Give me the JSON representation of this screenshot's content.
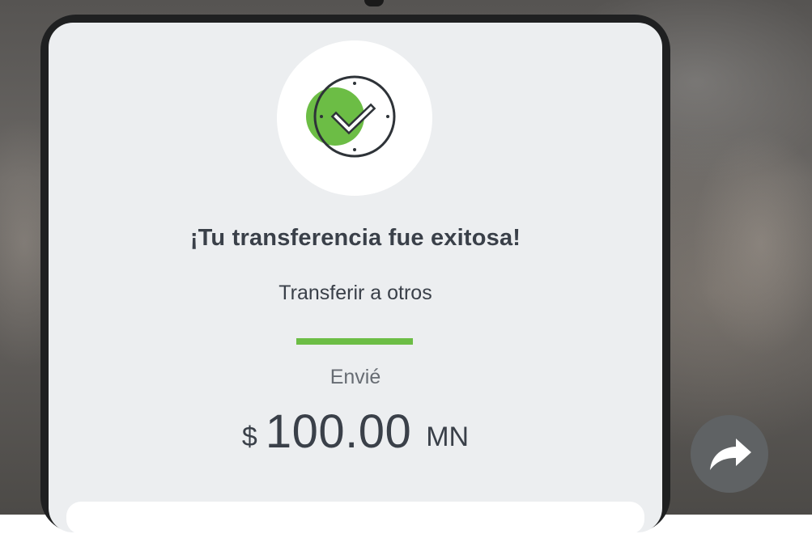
{
  "success": {
    "title": "¡Tu transferencia fue exitosa!",
    "subtitle": "Transferir a otros",
    "icon": "clock-check-icon"
  },
  "amount": {
    "label": "Envié",
    "currency_symbol": "$",
    "value": "100.00",
    "currency_code": "MN"
  },
  "actions": {
    "share_icon": "share-arrow-icon"
  },
  "colors": {
    "accent_green": "#6cbd45",
    "card_background": "#eceef0",
    "text_dark": "#3a4049",
    "text_muted": "#676c73",
    "share_button": "#5f6264"
  }
}
